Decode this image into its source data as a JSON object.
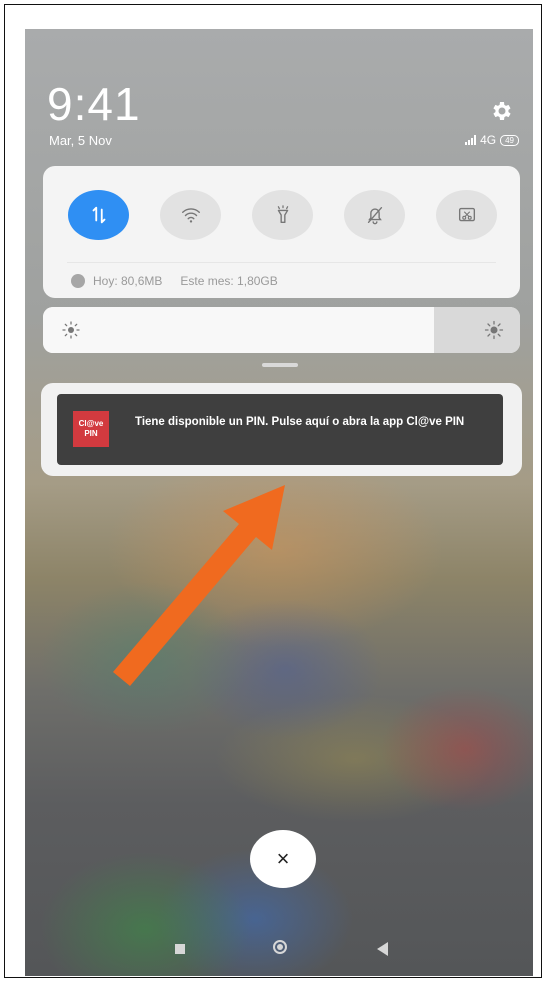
{
  "status_bar": {
    "time": "9:41",
    "date": "Mar, 5 Nov",
    "network": "4G",
    "battery": "49"
  },
  "quick_settings": {
    "toggles": [
      {
        "icon": "mobile-data-icon",
        "active": true
      },
      {
        "icon": "wifi-icon",
        "active": false
      },
      {
        "icon": "flashlight-icon",
        "active": false
      },
      {
        "icon": "silent-mode-icon",
        "active": false
      },
      {
        "icon": "screenshot-icon",
        "active": false
      }
    ],
    "data_usage": {
      "today": "Hoy: 80,6MB",
      "month": "Este mes: 1,80GB"
    }
  },
  "brightness": {
    "level": 0.82
  },
  "notification": {
    "app_icon_line1": "Cl@ve",
    "app_icon_line2": "PIN",
    "text": "Tiene disponible un PIN. Pulse aquí o abra la app Cl@ve PIN"
  },
  "clear_button": {
    "label": "×"
  },
  "colors": {
    "accent": "#2f8ff3",
    "arrow": "#f06a1f",
    "notification_bg": "#3f3f3f",
    "app_icon_bg": "#d23a3f"
  }
}
